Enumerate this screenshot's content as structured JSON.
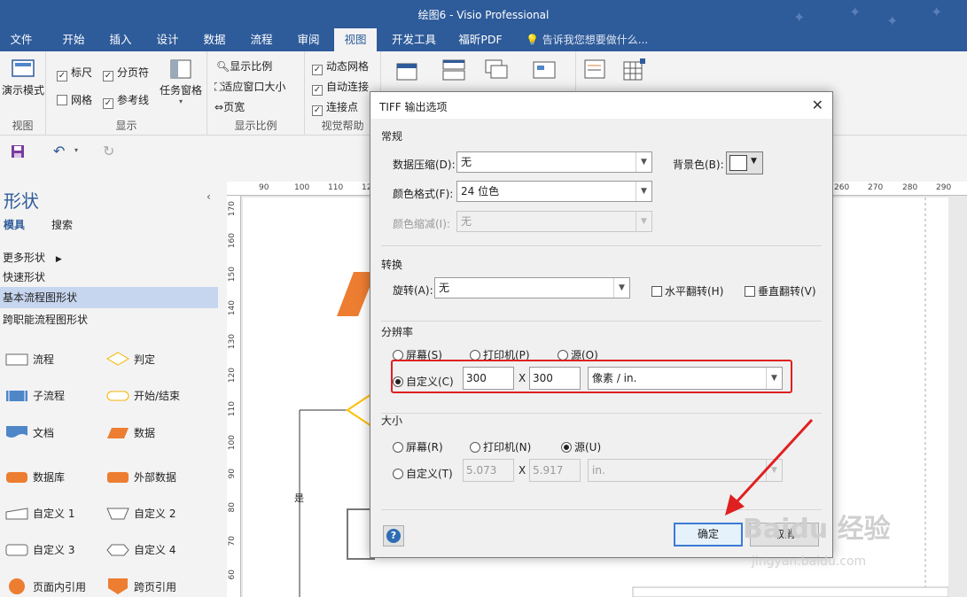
{
  "window": {
    "title": "绘图6 - Visio Professional"
  },
  "ribbon_tabs": [
    {
      "label": "文件"
    },
    {
      "label": "开始"
    },
    {
      "label": "插入"
    },
    {
      "label": "设计"
    },
    {
      "label": "数据"
    },
    {
      "label": "流程"
    },
    {
      "label": "审阅"
    },
    {
      "label": "视图"
    },
    {
      "label": "开发工具"
    },
    {
      "label": "福昕PDF"
    }
  ],
  "tell_me": "告诉我您想要做什么...",
  "ribbon": {
    "view_group": {
      "present_mode": "演示模式",
      "label": "视图"
    },
    "show_group": {
      "ruler": "标尺",
      "page_breaks": "分页符",
      "grid": "网格",
      "guides": "参考线",
      "task_panes": "任务窗格",
      "label": "显示"
    },
    "zoom_group": {
      "zoom": "显示比例",
      "fit_window": "适应窗口大小",
      "page_width": "页宽",
      "label": "显示比例"
    },
    "visual_aids_group": {
      "dynamic_grid": "动态网格",
      "autoconnect": "自动连接",
      "connection_points": "连接点",
      "label": "视觉帮助"
    }
  },
  "shapes_pane": {
    "title": "形状",
    "tab_stencils": "模具",
    "tab_search": "搜索",
    "more_shapes": "更多形状",
    "quick_shapes": "快速形状",
    "basic_flowchart": "基本流程图形状",
    "cross_functional": "跨职能流程图形状",
    "stencils": [
      {
        "label": "流程"
      },
      {
        "label": "判定"
      },
      {
        "label": "子流程"
      },
      {
        "label": "开始/结束"
      },
      {
        "label": "文档"
      },
      {
        "label": "数据"
      },
      {
        "label": "数据库"
      },
      {
        "label": "外部数据"
      },
      {
        "label": "自定义 1"
      },
      {
        "label": "自定义 2"
      },
      {
        "label": "自定义 3"
      },
      {
        "label": "自定义 4"
      },
      {
        "label": "页面内引用"
      },
      {
        "label": "跨页引用"
      }
    ]
  },
  "ruler": {
    "top": [
      "90",
      "100",
      "110",
      "12",
      "260",
      "270",
      "280",
      "290"
    ],
    "left": [
      "170",
      "160",
      "150",
      "140",
      "130",
      "120",
      "110",
      "100",
      "90",
      "80",
      "70",
      "60"
    ]
  },
  "canvas": {
    "yes_label": "是"
  },
  "dialog": {
    "title": "TIFF 输出选项",
    "general": {
      "header": "常规",
      "compression_label": "数据压缩(D):",
      "compression_value": "无",
      "background_label": "背景色(B):",
      "color_format_label": "颜色格式(F):",
      "color_format_value": "24 位色",
      "color_reduction_label": "颜色缩减(I):",
      "color_reduction_value": "无"
    },
    "transform": {
      "header": "转换",
      "rotate_label": "旋转(A):",
      "rotate_value": "无",
      "flip_h": "水平翻转(H)",
      "flip_v": "垂直翻转(V)"
    },
    "resolution": {
      "header": "分辨率",
      "screen": "屏幕(S)",
      "printer": "打印机(P)",
      "source": "源(O)",
      "custom": "自定义(C)",
      "x_value": "300",
      "y_value": "300",
      "times": "X",
      "unit": "像素 / in."
    },
    "size": {
      "header": "大小",
      "screen": "屏幕(R)",
      "printer": "打印机(N)",
      "source": "源(U)",
      "custom": "自定义(T)",
      "width": "5.073",
      "height": "5.917",
      "times": "X",
      "unit": "in."
    },
    "ok": "确定",
    "cancel": "取消",
    "help": "?"
  },
  "watermark": {
    "brand": "Baidu 经验",
    "url": "jingyan.baidu.com"
  },
  "colors": {
    "accent": "#2e5b9a",
    "highlight": "#e02020",
    "shape_orange": "#ed7d31",
    "shape_blue": "#4e86c8",
    "shape_yellow": "#ffc000"
  }
}
